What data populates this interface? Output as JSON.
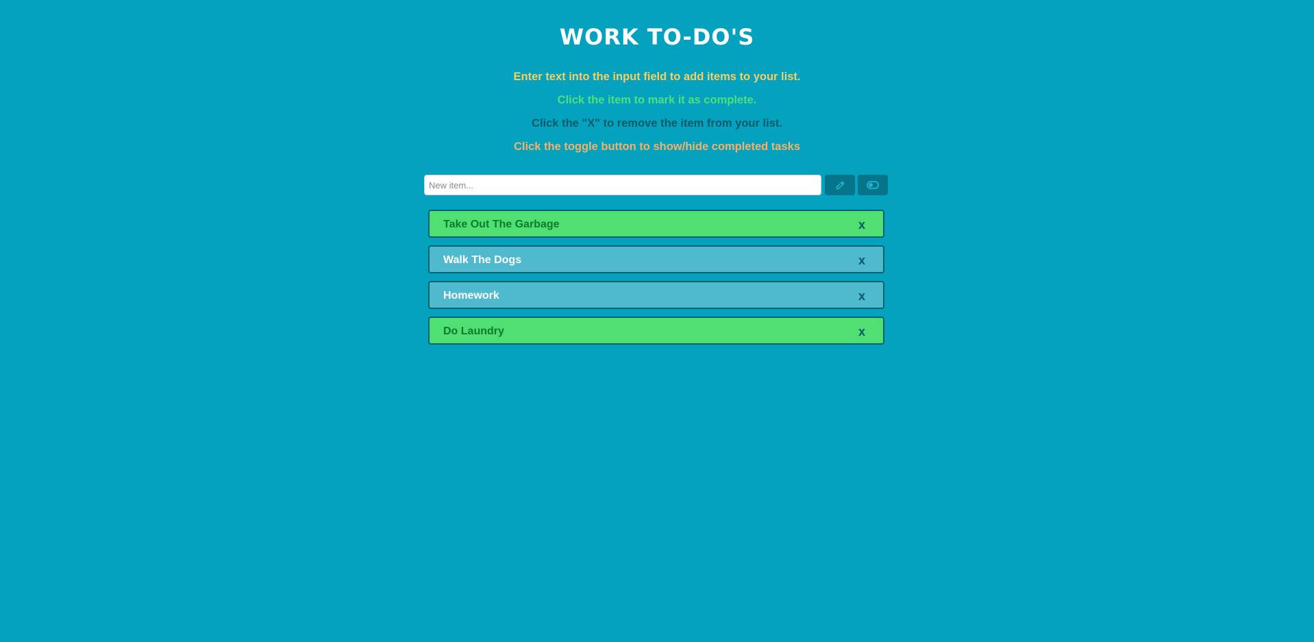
{
  "header": {
    "title": "WORK TO-DO'S"
  },
  "instructions": [
    "Enter text into the input field to add items to your list.",
    "Click the item to mark it as complete.",
    "Click the \"X\" to remove the item from your list.",
    "Click the toggle button to show/hide completed tasks"
  ],
  "new_item": {
    "placeholder": "New item...",
    "value": ""
  },
  "buttons": {
    "edit_icon": "pencil-icon",
    "toggle_icon": "toggle-icon"
  },
  "items": [
    {
      "label": "Take Out The Garbage",
      "completed": true,
      "remove": "x"
    },
    {
      "label": "Walk The Dogs",
      "completed": false,
      "remove": "x"
    },
    {
      "label": "Homework",
      "completed": false,
      "remove": "x"
    },
    {
      "label": "Do Laundry",
      "completed": true,
      "remove": "x"
    }
  ],
  "colors": {
    "background": "#04a2bf",
    "completed": "#50df73",
    "pending": "#4fb9ce",
    "button": "#06758b"
  }
}
